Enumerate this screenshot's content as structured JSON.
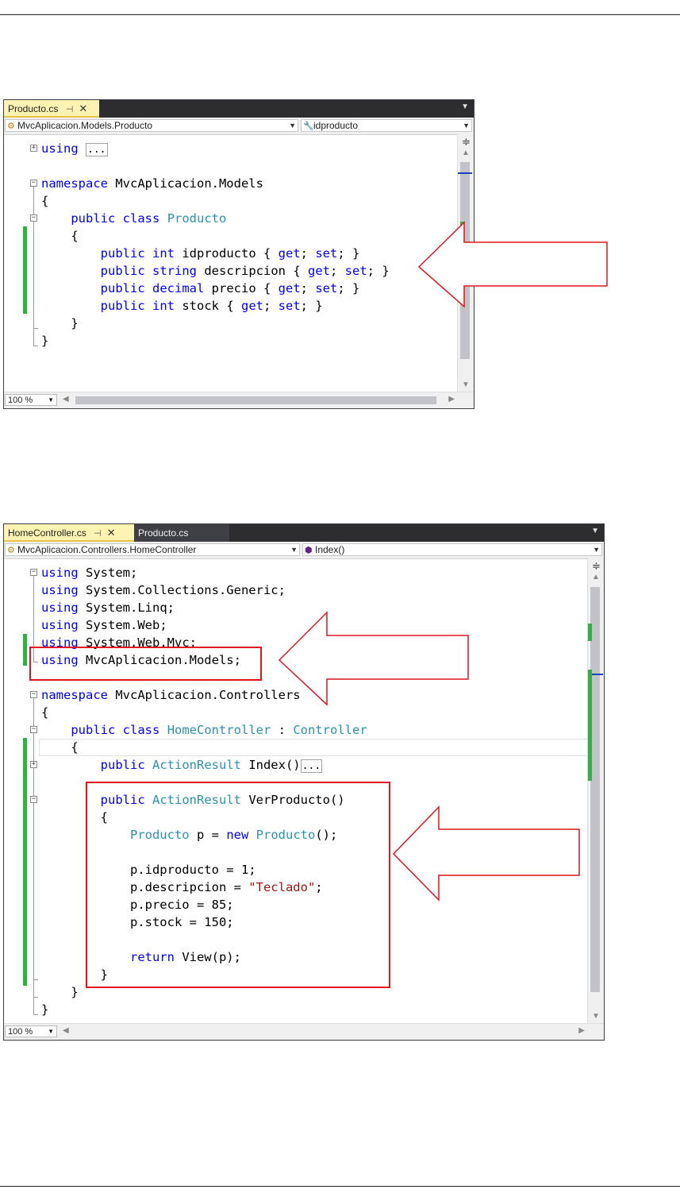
{
  "editor1": {
    "tabs": [
      {
        "label": "Producto.cs",
        "active": true
      }
    ],
    "nav_left": "MvcAplicacion.Models.Producto",
    "nav_right": "idproducto",
    "zoom": "100 %",
    "lines": [
      [
        {
          "t": "using",
          "c": "kw"
        },
        {
          "t": " "
        },
        {
          "t": "...",
          "c": "col"
        }
      ],
      [],
      [
        {
          "t": "namespace",
          "c": "kw"
        },
        {
          "t": " MvcAplicacion.Models"
        }
      ],
      [
        {
          "t": "{"
        }
      ],
      [
        {
          "t": "    "
        },
        {
          "t": "public",
          "c": "kw"
        },
        {
          "t": " "
        },
        {
          "t": "class",
          "c": "kw"
        },
        {
          "t": " "
        },
        {
          "t": "Producto",
          "c": "ty"
        }
      ],
      [
        {
          "t": "    {"
        }
      ],
      [
        {
          "t": "        "
        },
        {
          "t": "public",
          "c": "kw"
        },
        {
          "t": " "
        },
        {
          "t": "int",
          "c": "kw"
        },
        {
          "t": " idproducto { "
        },
        {
          "t": "get",
          "c": "kw"
        },
        {
          "t": "; "
        },
        {
          "t": "set",
          "c": "kw"
        },
        {
          "t": "; }"
        }
      ],
      [
        {
          "t": "        "
        },
        {
          "t": "public",
          "c": "kw"
        },
        {
          "t": " "
        },
        {
          "t": "string",
          "c": "kw"
        },
        {
          "t": " descripcion { "
        },
        {
          "t": "get",
          "c": "kw"
        },
        {
          "t": "; "
        },
        {
          "t": "set",
          "c": "kw"
        },
        {
          "t": "; }"
        }
      ],
      [
        {
          "t": "        "
        },
        {
          "t": "public",
          "c": "kw"
        },
        {
          "t": " "
        },
        {
          "t": "decimal",
          "c": "kw"
        },
        {
          "t": " precio { "
        },
        {
          "t": "get",
          "c": "kw"
        },
        {
          "t": "; "
        },
        {
          "t": "set",
          "c": "kw"
        },
        {
          "t": "; }"
        }
      ],
      [
        {
          "t": "        "
        },
        {
          "t": "public",
          "c": "kw"
        },
        {
          "t": " "
        },
        {
          "t": "int",
          "c": "kw"
        },
        {
          "t": " stock { "
        },
        {
          "t": "get",
          "c": "kw"
        },
        {
          "t": "; "
        },
        {
          "t": "set",
          "c": "kw"
        },
        {
          "t": "; }"
        }
      ],
      [
        {
          "t": "    }"
        }
      ],
      [
        {
          "t": "}"
        }
      ]
    ]
  },
  "editor2": {
    "tabs": [
      {
        "label": "HomeController.cs",
        "active": true
      },
      {
        "label": "Producto.cs",
        "active": false
      }
    ],
    "nav_left": "MvcAplicacion.Controllers.HomeController",
    "nav_right": "Index()",
    "zoom": "100 %",
    "lines": [
      [
        {
          "t": "using",
          "c": "kw"
        },
        {
          "t": " System;"
        }
      ],
      [
        {
          "t": "using",
          "c": "kw"
        },
        {
          "t": " System.Collections.Generic;"
        }
      ],
      [
        {
          "t": "using",
          "c": "kw"
        },
        {
          "t": " System.Linq;"
        }
      ],
      [
        {
          "t": "using",
          "c": "kw"
        },
        {
          "t": " System.Web;"
        }
      ],
      [
        {
          "t": "using",
          "c": "kw"
        },
        {
          "t": " System.Web.Mvc;"
        }
      ],
      [
        {
          "t": "using",
          "c": "kw"
        },
        {
          "t": " MvcAplicacion.Models;"
        }
      ],
      [],
      [
        {
          "t": "namespace",
          "c": "kw"
        },
        {
          "t": " MvcAplicacion.Controllers"
        }
      ],
      [
        {
          "t": "{"
        }
      ],
      [
        {
          "t": "    "
        },
        {
          "t": "public",
          "c": "kw"
        },
        {
          "t": " "
        },
        {
          "t": "class",
          "c": "kw"
        },
        {
          "t": " "
        },
        {
          "t": "HomeController",
          "c": "ty"
        },
        {
          "t": " : "
        },
        {
          "t": "Controller",
          "c": "ty"
        }
      ],
      [
        {
          "t": "    {"
        }
      ],
      [
        {
          "t": "        "
        },
        {
          "t": "public",
          "c": "kw"
        },
        {
          "t": " "
        },
        {
          "t": "ActionResult",
          "c": "ty"
        },
        {
          "t": " Index()"
        },
        {
          "t": "...",
          "c": "col"
        }
      ],
      [],
      [
        {
          "t": "        "
        },
        {
          "t": "public",
          "c": "kw"
        },
        {
          "t": " "
        },
        {
          "t": "ActionResult",
          "c": "ty"
        },
        {
          "t": " VerProducto()"
        }
      ],
      [
        {
          "t": "        {"
        }
      ],
      [
        {
          "t": "            "
        },
        {
          "t": "Producto",
          "c": "ty"
        },
        {
          "t": " p = "
        },
        {
          "t": "new",
          "c": "kw"
        },
        {
          "t": " "
        },
        {
          "t": "Producto",
          "c": "ty"
        },
        {
          "t": "();"
        }
      ],
      [],
      [
        {
          "t": "            p.idproducto = 1;"
        }
      ],
      [
        {
          "t": "            p.descripcion = "
        },
        {
          "t": "\"Teclado\"",
          "c": "st"
        },
        {
          "t": ";"
        }
      ],
      [
        {
          "t": "            p.precio = 85;"
        }
      ],
      [
        {
          "t": "            p.stock = 150;"
        }
      ],
      [],
      [
        {
          "t": "            "
        },
        {
          "t": "return",
          "c": "kw"
        },
        {
          "t": " View(p);"
        }
      ],
      [
        {
          "t": "        }"
        }
      ],
      [
        {
          "t": "    }"
        }
      ],
      [
        {
          "t": "}"
        }
      ]
    ]
  }
}
